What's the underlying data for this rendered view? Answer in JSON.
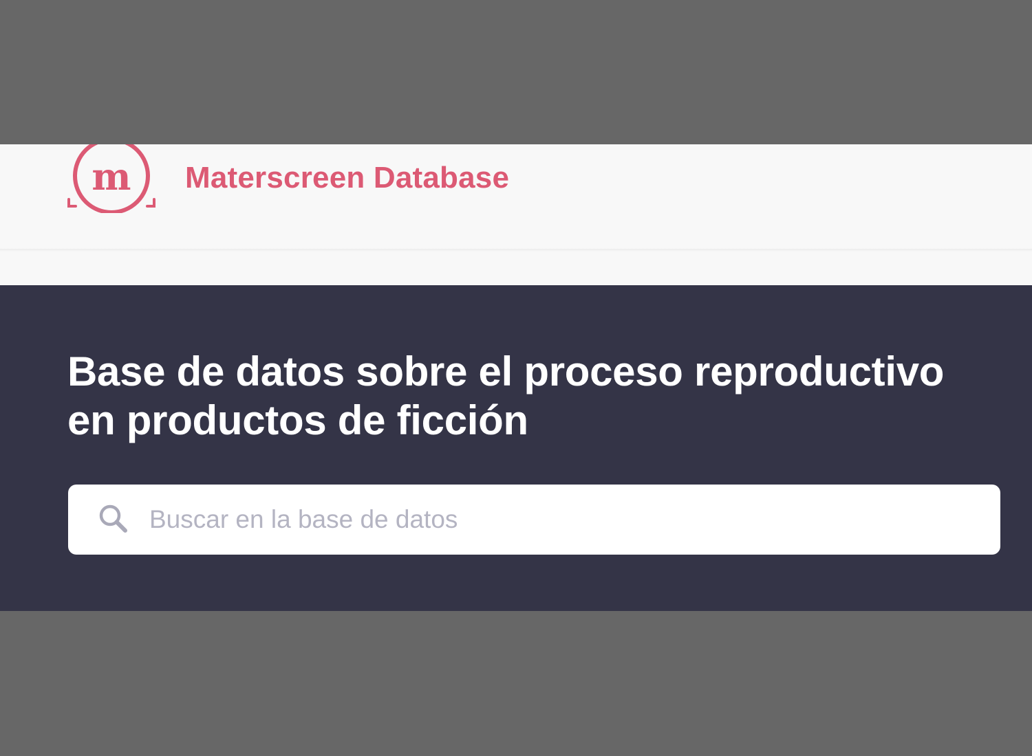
{
  "header": {
    "logo_letter": "m",
    "brand_name": "Materscreen Database"
  },
  "hero": {
    "title": "Base de datos sobre el proceso reproductivo en productos de ficción"
  },
  "search": {
    "placeholder": "Buscar en la base de datos",
    "value": ""
  },
  "colors": {
    "brand": "#dc5a74",
    "hero_background": "#343447",
    "header_background": "#f8f8f8",
    "placeholder": "#b4b4c2"
  }
}
